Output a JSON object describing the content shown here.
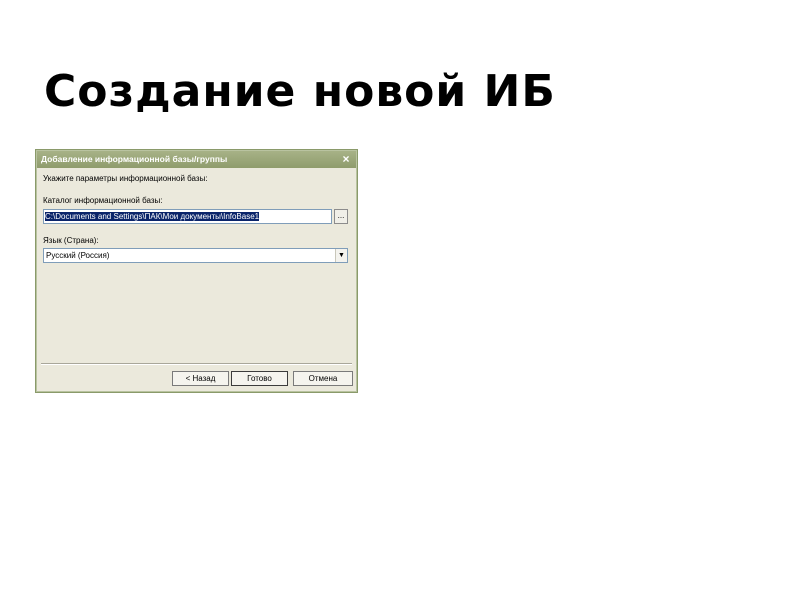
{
  "slide": {
    "title": "Создание новой ИБ"
  },
  "dialog": {
    "title": "Добавление информационной базы/группы",
    "close_label": "×",
    "instruction": "Укажите параметры информационной базы:",
    "catalog_label": "Каталог информационной базы:",
    "catalog_value": "C:\\Documents and Settings\\ПАК\\Мои документы\\InfoBase1",
    "browse_label": "...",
    "language_label": "Язык (Страна):",
    "language_value": "Русский (Россия)",
    "dropdown_arrow": "▼",
    "buttons": {
      "back": "< Назад",
      "finish": "Готово",
      "cancel": "Отмена"
    }
  },
  "colors": {
    "titlebar": "#8f9c6c",
    "dialog_bg": "#ebe9dc",
    "selection": "#0a246a"
  }
}
